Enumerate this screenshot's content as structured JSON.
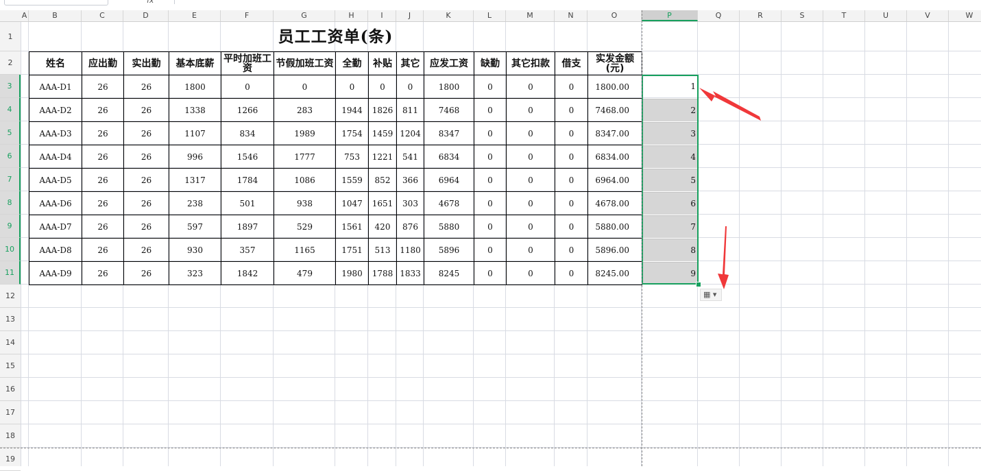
{
  "columns": [
    "A",
    "B",
    "C",
    "D",
    "E",
    "F",
    "G",
    "H",
    "I",
    "J",
    "K",
    "L",
    "M",
    "N",
    "O",
    "P",
    "Q",
    "R",
    "S",
    "T",
    "U",
    "V",
    "W"
  ],
  "selected_column": "P",
  "rows": [
    "1",
    "2",
    "3",
    "4",
    "5",
    "6",
    "7",
    "8",
    "9",
    "10",
    "11",
    "12",
    "13",
    "14",
    "15",
    "16",
    "17",
    "18",
    "19"
  ],
  "title": "员工工资单(条)",
  "headers": [
    "姓名",
    "应出勤",
    "实出勤",
    "基本底薪",
    "平时加班工资",
    "节假加班工资",
    "全勤",
    "补贴",
    "其它",
    "应发工资",
    "缺勤",
    "其它扣款",
    "借支",
    "实发金额(元)"
  ],
  "records": [
    [
      "AAA-D1",
      "26",
      "26",
      "1800",
      "0",
      "0",
      "0",
      "0",
      "0",
      "1800",
      "0",
      "0",
      "0",
      "1800.00"
    ],
    [
      "AAA-D2",
      "26",
      "26",
      "1338",
      "1266",
      "283",
      "1944",
      "1826",
      "811",
      "7468",
      "0",
      "0",
      "0",
      "7468.00"
    ],
    [
      "AAA-D3",
      "26",
      "26",
      "1107",
      "834",
      "1989",
      "1754",
      "1459",
      "1204",
      "8347",
      "0",
      "0",
      "0",
      "8347.00"
    ],
    [
      "AAA-D4",
      "26",
      "26",
      "996",
      "1546",
      "1777",
      "753",
      "1221",
      "541",
      "6834",
      "0",
      "0",
      "0",
      "6834.00"
    ],
    [
      "AAA-D5",
      "26",
      "26",
      "1317",
      "1784",
      "1086",
      "1559",
      "852",
      "366",
      "6964",
      "0",
      "0",
      "0",
      "6964.00"
    ],
    [
      "AAA-D6",
      "26",
      "26",
      "238",
      "501",
      "938",
      "1047",
      "1651",
      "303",
      "4678",
      "0",
      "0",
      "0",
      "4678.00"
    ],
    [
      "AAA-D7",
      "26",
      "26",
      "597",
      "1897",
      "529",
      "1561",
      "420",
      "876",
      "5880",
      "0",
      "0",
      "0",
      "5880.00"
    ],
    [
      "AAA-D8",
      "26",
      "26",
      "930",
      "357",
      "1165",
      "1751",
      "513",
      "1180",
      "5896",
      "0",
      "0",
      "0",
      "5896.00"
    ],
    [
      "AAA-D9",
      "26",
      "26",
      "323",
      "1842",
      "479",
      "1980",
      "1788",
      "1833",
      "8245",
      "0",
      "0",
      "0",
      "8245.00"
    ]
  ],
  "p_values": [
    "1",
    "2",
    "3",
    "4",
    "5",
    "6",
    "7",
    "8",
    "9"
  ],
  "paste_options_icon": "autofill-options-icon",
  "accent_color": "#17a05e",
  "arrow_color": "#f0383a"
}
